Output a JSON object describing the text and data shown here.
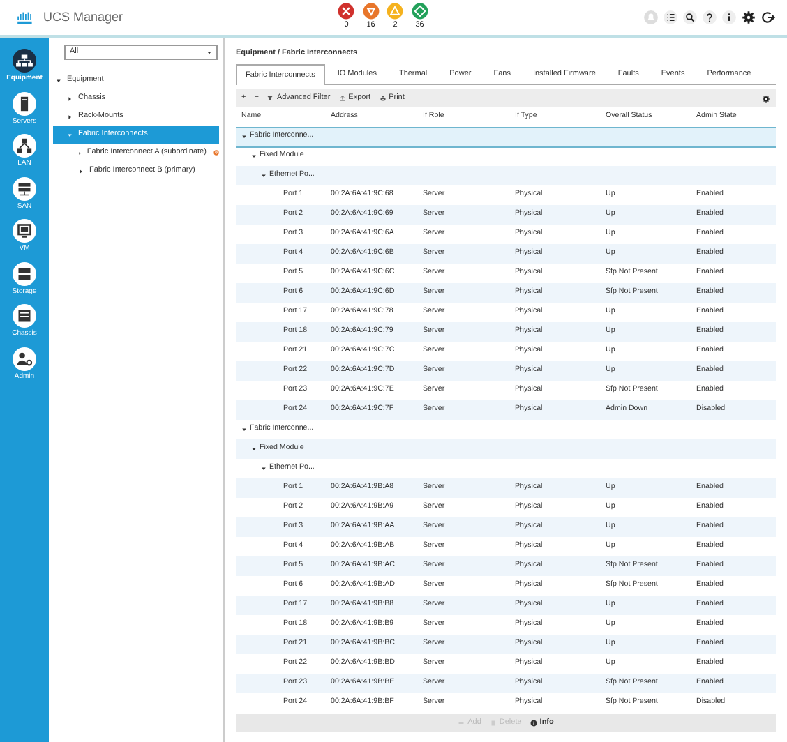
{
  "header": {
    "title": "UCS Manager",
    "alarms": [
      {
        "kind": "critical",
        "count": "0"
      },
      {
        "kind": "major",
        "count": "16"
      },
      {
        "kind": "minor",
        "count": "2"
      },
      {
        "kind": "warning",
        "count": "36"
      }
    ]
  },
  "rail": [
    {
      "kind": "equipment",
      "label": "Equipment",
      "selected": true
    },
    {
      "kind": "servers",
      "label": "Servers",
      "selected": false
    },
    {
      "kind": "lan",
      "label": "LAN",
      "selected": false
    },
    {
      "kind": "san",
      "label": "SAN",
      "selected": false
    },
    {
      "kind": "vm",
      "label": "VM",
      "selected": false
    },
    {
      "kind": "storage",
      "label": "Storage",
      "selected": false
    },
    {
      "kind": "chassis",
      "label": "Chassis",
      "selected": false
    },
    {
      "kind": "admin",
      "label": "Admin",
      "selected": false
    }
  ],
  "filter": {
    "value": "All"
  },
  "tree": [
    {
      "label": "Equipment",
      "expanded": true,
      "selected": false,
      "children": [
        {
          "label": "Chassis",
          "expanded": false,
          "selected": false
        },
        {
          "label": "Rack-Mounts",
          "expanded": false,
          "selected": false
        },
        {
          "label": "Fabric Interconnects",
          "expanded": true,
          "selected": true,
          "children": [
            {
              "label": "Fabric Interconnect A (subordinate)",
              "expanded": false,
              "selected": false,
              "fault": true
            },
            {
              "label": "Fabric Interconnect B (primary)",
              "expanded": false,
              "selected": false,
              "fault": false
            }
          ]
        }
      ]
    }
  ],
  "breadcrumb": "Equipment / Fabric Interconnects",
  "tabs": [
    {
      "label": "Fabric Interconnects",
      "selected": true
    },
    {
      "label": "IO Modules",
      "selected": false
    },
    {
      "label": "Thermal",
      "selected": false
    },
    {
      "label": "Power",
      "selected": false
    },
    {
      "label": "Fans",
      "selected": false
    },
    {
      "label": "Installed Firmware",
      "selected": false
    },
    {
      "label": "Faults",
      "selected": false
    },
    {
      "label": "Events",
      "selected": false
    },
    {
      "label": "Performance",
      "selected": false
    }
  ],
  "toolbar": [
    {
      "kind": "add",
      "label": "+"
    },
    {
      "kind": "remove",
      "label": "−"
    },
    {
      "kind": "filter",
      "label": "Advanced Filter"
    },
    {
      "kind": "export",
      "label": "Export"
    },
    {
      "kind": "print",
      "label": "Print"
    }
  ],
  "table": {
    "columns": [
      "Name",
      "Address",
      "If Role",
      "If Type",
      "Overall Status",
      "Admin State"
    ],
    "rows": [
      {
        "name": "Fabric Interconne...",
        "expanded": true,
        "selected": true,
        "children": [
          {
            "name": "Fixed Module",
            "expanded": true,
            "selected": false,
            "children": [
              {
                "name": "Ethernet Po...",
                "expanded": true,
                "selected": false,
                "children": [
                  {
                    "name": "Port 1",
                    "address": "00:2A:6A:41:9C:68",
                    "role": "Server",
                    "type": "Physical",
                    "status": "Up",
                    "admin": "Enabled",
                    "selected": false
                  },
                  {
                    "name": "Port 2",
                    "address": "00:2A:6A:41:9C:69",
                    "role": "Server",
                    "type": "Physical",
                    "status": "Up",
                    "admin": "Enabled",
                    "selected": false
                  },
                  {
                    "name": "Port 3",
                    "address": "00:2A:6A:41:9C:6A",
                    "role": "Server",
                    "type": "Physical",
                    "status": "Up",
                    "admin": "Enabled",
                    "selected": false
                  },
                  {
                    "name": "Port 4",
                    "address": "00:2A:6A:41:9C:6B",
                    "role": "Server",
                    "type": "Physical",
                    "status": "Up",
                    "admin": "Enabled",
                    "selected": false
                  },
                  {
                    "name": "Port 5",
                    "address": "00:2A:6A:41:9C:6C",
                    "role": "Server",
                    "type": "Physical",
                    "status": "Sfp Not Present",
                    "admin": "Enabled",
                    "selected": false
                  },
                  {
                    "name": "Port 6",
                    "address": "00:2A:6A:41:9C:6D",
                    "role": "Server",
                    "type": "Physical",
                    "status": "Sfp Not Present",
                    "admin": "Enabled",
                    "selected": false
                  },
                  {
                    "name": "Port 17",
                    "address": "00:2A:6A:41:9C:78",
                    "role": "Server",
                    "type": "Physical",
                    "status": "Up",
                    "admin": "Enabled",
                    "selected": false
                  },
                  {
                    "name": "Port 18",
                    "address": "00:2A:6A:41:9C:79",
                    "role": "Server",
                    "type": "Physical",
                    "status": "Up",
                    "admin": "Enabled",
                    "selected": false
                  },
                  {
                    "name": "Port 21",
                    "address": "00:2A:6A:41:9C:7C",
                    "role": "Server",
                    "type": "Physical",
                    "status": "Up",
                    "admin": "Enabled",
                    "selected": false
                  },
                  {
                    "name": "Port 22",
                    "address": "00:2A:6A:41:9C:7D",
                    "role": "Server",
                    "type": "Physical",
                    "status": "Up",
                    "admin": "Enabled",
                    "selected": false
                  },
                  {
                    "name": "Port 23",
                    "address": "00:2A:6A:41:9C:7E",
                    "role": "Server",
                    "type": "Physical",
                    "status": "Sfp Not Present",
                    "admin": "Enabled",
                    "selected": false
                  },
                  {
                    "name": "Port 24",
                    "address": "00:2A:6A:41:9C:7F",
                    "role": "Server",
                    "type": "Physical",
                    "status": "Admin Down",
                    "admin": "Disabled",
                    "selected": false
                  }
                ]
              }
            ]
          }
        ]
      },
      {
        "name": "Fabric Interconne...",
        "expanded": true,
        "selected": false,
        "children": [
          {
            "name": "Fixed Module",
            "expanded": true,
            "selected": false,
            "children": [
              {
                "name": "Ethernet Po...",
                "expanded": true,
                "selected": false,
                "children": [
                  {
                    "name": "Port 1",
                    "address": "00:2A:6A:41:9B:A8",
                    "role": "Server",
                    "type": "Physical",
                    "status": "Up",
                    "admin": "Enabled",
                    "selected": false
                  },
                  {
                    "name": "Port 2",
                    "address": "00:2A:6A:41:9B:A9",
                    "role": "Server",
                    "type": "Physical",
                    "status": "Up",
                    "admin": "Enabled",
                    "selected": false
                  },
                  {
                    "name": "Port 3",
                    "address": "00:2A:6A:41:9B:AA",
                    "role": "Server",
                    "type": "Physical",
                    "status": "Up",
                    "admin": "Enabled",
                    "selected": false
                  },
                  {
                    "name": "Port 4",
                    "address": "00:2A:6A:41:9B:AB",
                    "role": "Server",
                    "type": "Physical",
                    "status": "Up",
                    "admin": "Enabled",
                    "selected": false
                  },
                  {
                    "name": "Port 5",
                    "address": "00:2A:6A:41:9B:AC",
                    "role": "Server",
                    "type": "Physical",
                    "status": "Sfp Not Present",
                    "admin": "Enabled",
                    "selected": false
                  },
                  {
                    "name": "Port 6",
                    "address": "00:2A:6A:41:9B:AD",
                    "role": "Server",
                    "type": "Physical",
                    "status": "Sfp Not Present",
                    "admin": "Enabled",
                    "selected": false
                  },
                  {
                    "name": "Port 17",
                    "address": "00:2A:6A:41:9B:B8",
                    "role": "Server",
                    "type": "Physical",
                    "status": "Up",
                    "admin": "Enabled",
                    "selected": false
                  },
                  {
                    "name": "Port 18",
                    "address": "00:2A:6A:41:9B:B9",
                    "role": "Server",
                    "type": "Physical",
                    "status": "Up",
                    "admin": "Enabled",
                    "selected": false
                  },
                  {
                    "name": "Port 21",
                    "address": "00:2A:6A:41:9B:BC",
                    "role": "Server",
                    "type": "Physical",
                    "status": "Up",
                    "admin": "Enabled",
                    "selected": false
                  },
                  {
                    "name": "Port 22",
                    "address": "00:2A:6A:41:9B:BD",
                    "role": "Server",
                    "type": "Physical",
                    "status": "Up",
                    "admin": "Enabled",
                    "selected": false
                  },
                  {
                    "name": "Port 23",
                    "address": "00:2A:6A:41:9B:BE",
                    "role": "Server",
                    "type": "Physical",
                    "status": "Sfp Not Present",
                    "admin": "Enabled",
                    "selected": false
                  },
                  {
                    "name": "Port 24",
                    "address": "00:2A:6A:41:9B:BF",
                    "role": "Server",
                    "type": "Physical",
                    "status": "Sfp Not Present",
                    "admin": "Disabled",
                    "selected": false
                  }
                ]
              }
            ]
          }
        ]
      }
    ]
  },
  "footer": [
    {
      "kind": "add",
      "label": "Add",
      "disabled": true
    },
    {
      "kind": "delete",
      "label": "Delete",
      "disabled": true
    },
    {
      "kind": "info",
      "label": "Info",
      "disabled": false
    }
  ]
}
